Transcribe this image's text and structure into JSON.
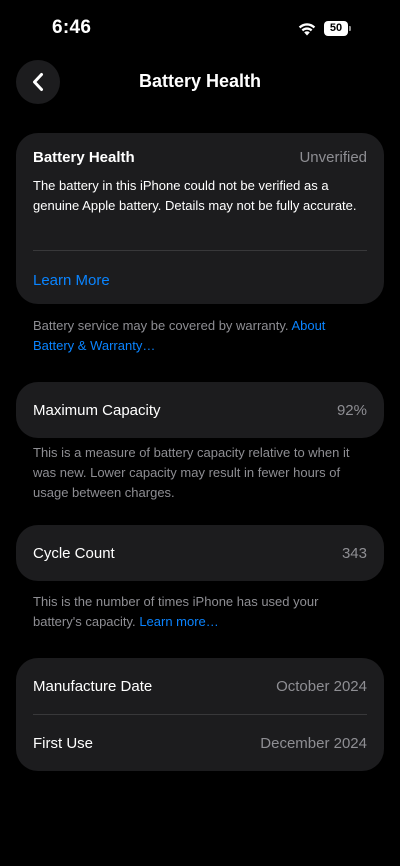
{
  "status_bar": {
    "time": "6:46",
    "battery_level": "50",
    "icons": [
      "wifi-icon",
      "battery-icon"
    ]
  },
  "nav": {
    "title": "Battery Health",
    "back_icon": "chevron-left-icon"
  },
  "battery_health_card": {
    "label": "Battery Health",
    "value": "Unverified",
    "description": "The battery in this iPhone could not be verified as a genuine Apple battery. Details may not be fully accurate.",
    "link": "Learn More"
  },
  "warranty_note": {
    "text": "Battery service may be covered by warranty.",
    "link": "About Battery & Warranty…"
  },
  "maximum_capacity": {
    "label": "Maximum Capacity",
    "value": "92%",
    "note": "This is a measure of battery capacity relative to when it was new. Lower capacity may result in fewer hours of usage between charges."
  },
  "cycle_count": {
    "label": "Cycle Count",
    "value": "343",
    "note": "This is the number of times iPhone has used your battery's capacity.",
    "link": "Learn more…"
  },
  "dates_card": {
    "manufacture_label": "Manufacture Date",
    "manufacture_value": "October 2024",
    "first_use_label": "First Use",
    "first_use_value": "December 2024"
  },
  "colors": {
    "background": "#000000",
    "card": "#1c1c1e",
    "accent": "#0a84ff",
    "secondary_text": "#8e8e93"
  }
}
